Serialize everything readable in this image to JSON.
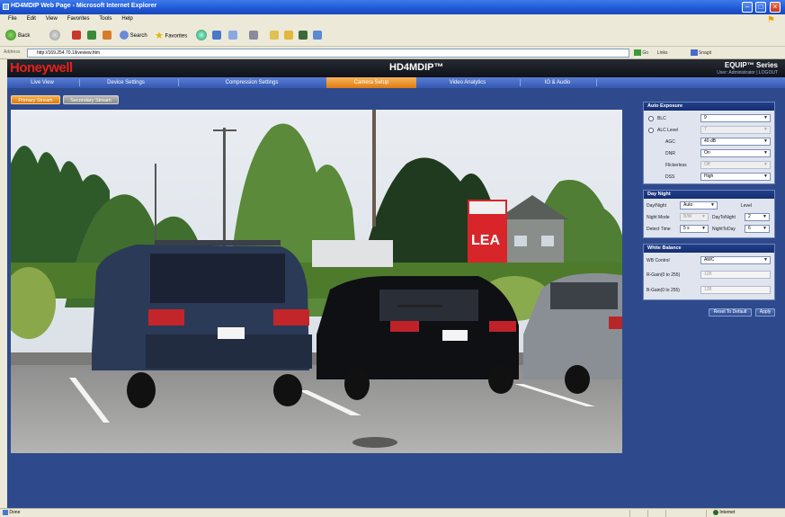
{
  "browser": {
    "title": "HD4MDIP Web Page - Microsoft Internet Explorer",
    "menu": [
      "File",
      "Edit",
      "View",
      "Favorites",
      "Tools",
      "Help"
    ],
    "toolbar": {
      "back": "Back",
      "search": "Search",
      "favorites": "Favorites"
    },
    "address_label": "Address",
    "address_value": "http://169.254.70.1/liveview.htm",
    "address_right": [
      "Go",
      "Links",
      "Snagit"
    ],
    "status_left": "Done",
    "status_right": "Internet"
  },
  "app": {
    "brand": "Honeywell",
    "model": "HD4MDIP™",
    "series": "EQUIP™ Series",
    "user_line": "User: Administrator | LOGOUT",
    "nav": [
      {
        "label": "Live View"
      },
      {
        "label": "Device Settings"
      },
      {
        "label": "Compression Settings"
      },
      {
        "label": "Camera Setup"
      },
      {
        "label": "Video Analytics"
      },
      {
        "label": "IO & Audio"
      }
    ],
    "active_nav": "Camera Setup",
    "subtabs": [
      {
        "label": "Primary Stream"
      },
      {
        "label": "Secondary Stream"
      }
    ],
    "video_sign_text": "LEA",
    "auto_exposure": {
      "title": "Auto Exposure",
      "blc_label": "BLC",
      "blc_value": "9",
      "alc_level_label": "ALC Level",
      "alc_level_value": "7",
      "agc_label": "AGC",
      "agc_value": "40 dB",
      "dnr_label": "DNR",
      "dnr_value": "On",
      "flickerless_label": "Flickerless",
      "flickerless_value": "Off",
      "dss_label": "DSS",
      "dss_value": "High"
    },
    "day_night": {
      "title": "Day Night",
      "day_night_label": "Day/Night",
      "day_night_value": "Auto",
      "level_label": "Level",
      "night_mode_label": "Night Mode",
      "night_mode_value": "B/W",
      "day_to_night_label": "DayToNight",
      "day_to_night_value": "2",
      "detect_time_label": "Detect Time",
      "detect_time_value": "5 s",
      "night_to_day_label": "NightToDay",
      "night_to_day_value": "6"
    },
    "white_balance": {
      "title": "White Balance",
      "wb_control_label": "WB Control",
      "wb_control_value": "AWC",
      "r_gain_label": "R-Gain(0 to 255)",
      "r_gain_value": "128",
      "b_gain_label": "B-Gain(0 to 255)",
      "b_gain_value": "128"
    },
    "buttons": {
      "reset": "Reset To Default",
      "apply": "Apply"
    }
  }
}
